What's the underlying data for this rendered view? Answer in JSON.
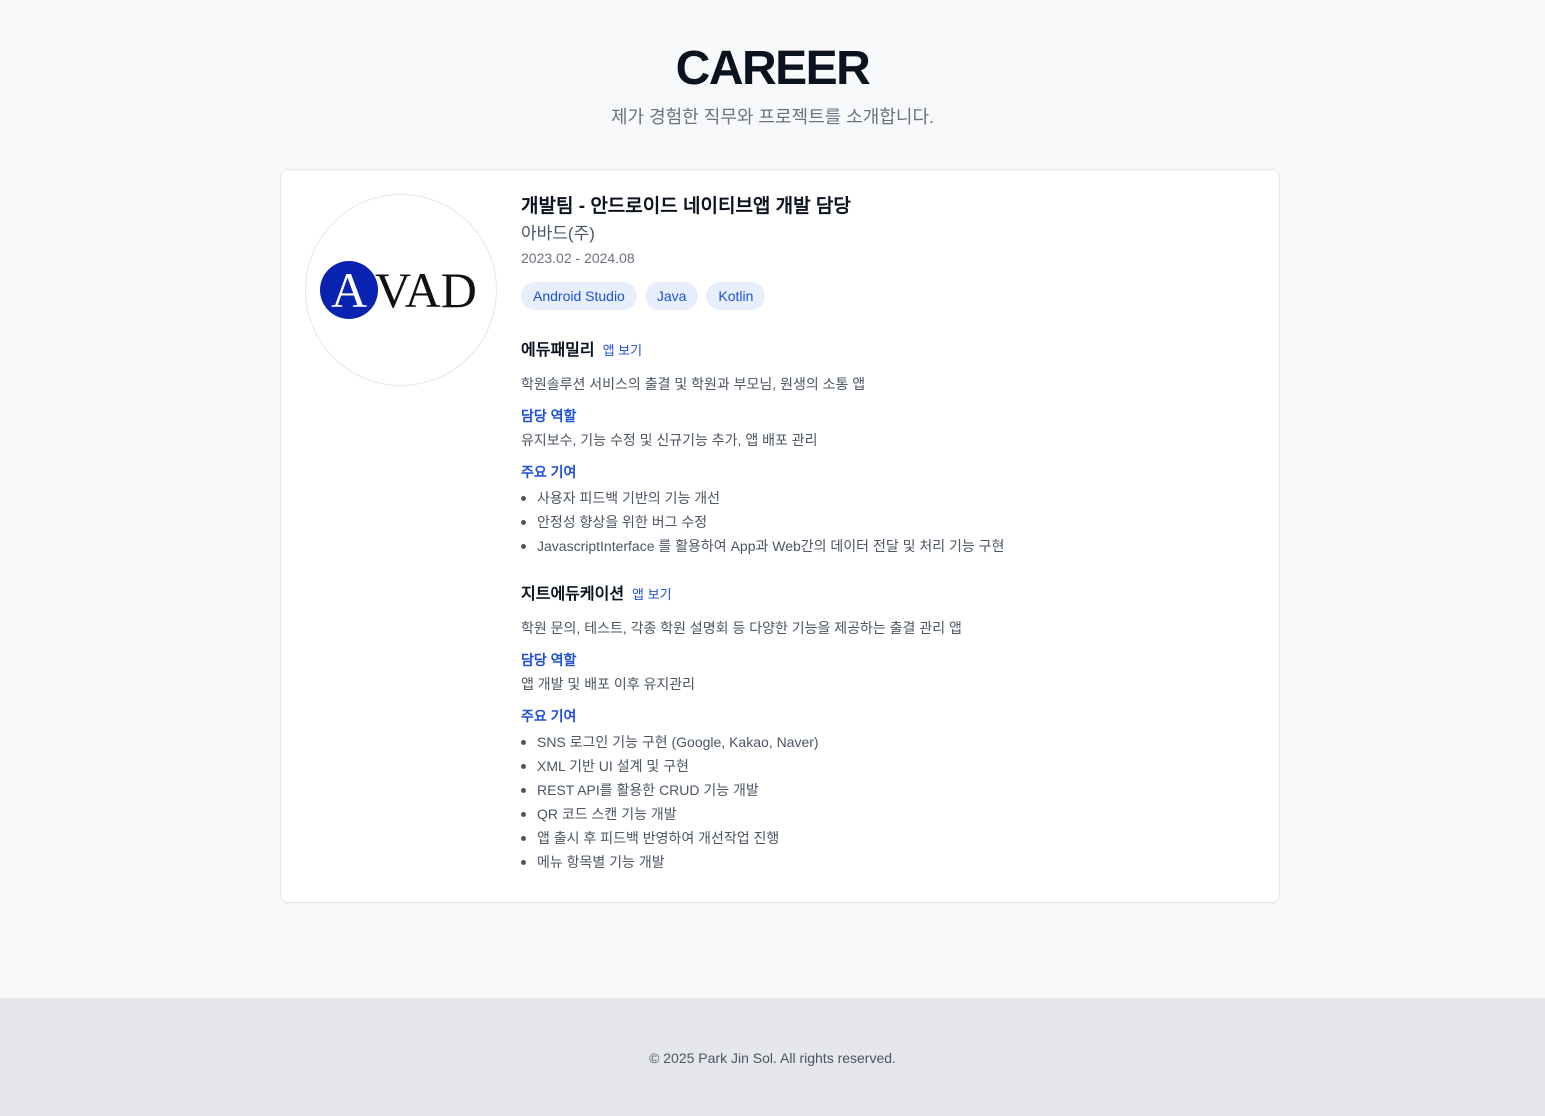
{
  "header": {
    "title": "CAREER",
    "subtitle": "제가 경험한 직무와 프로젝트를 소개합니다."
  },
  "career": {
    "logo": {
      "text_a": "A",
      "text_rest": "VAD",
      "accent": "#0a22b0"
    },
    "job_title": "개발팀 - 안드로이드 네이티브앱 개발 담당",
    "company": "아바드(주)",
    "period": "2023.02 - 2024.08",
    "tags": [
      "Android Studio",
      "Java",
      "Kotlin"
    ],
    "projects": [
      {
        "name": "에듀패밀리",
        "link_label": "앱 보기",
        "description": "학원솔루션 서비스의 출결 및 학원과 부모님, 원생의 소통 앱",
        "role_label": "담당 역할",
        "role": "유지보수, 기능 수정 및 신규기능 추가, 앱 배포 관리",
        "contrib_label": "주요 기여",
        "contributions": [
          "사용자 피드백 기반의 기능 개선",
          "안정성 향상을 위한 버그 수정",
          "JavascriptInterface 를 활용하여 App과 Web간의 데이터 전달 및 처리 기능 구현"
        ]
      },
      {
        "name": "지트에듀케이션",
        "link_label": "앱 보기",
        "description": "학원 문의, 테스트, 각종 학원 설명회 등 다양한 기능을 제공하는 출결 관리 앱",
        "role_label": "담당 역할",
        "role": "앱 개발 및 배포 이후 유지관리",
        "contrib_label": "주요 기여",
        "contributions": [
          "SNS 로그인 기능 구현 (Google, Kakao, Naver)",
          "XML 기반 UI 설계 및 구현",
          "REST API를 활용한 CRUD 기능 개발",
          "QR 코드 스캔 기능 개발",
          "앱 출시 후 피드백 반영하여 개선작업 진행",
          "메뉴 항목별 기능 개발"
        ]
      }
    ]
  },
  "footer": {
    "text": "© 2025 Park Jin Sol. All rights reserved."
  },
  "colors": {
    "accent": "#1d4fd8",
    "tag_bg": "#e8effc",
    "footer_bg": "#e5e7eb"
  }
}
